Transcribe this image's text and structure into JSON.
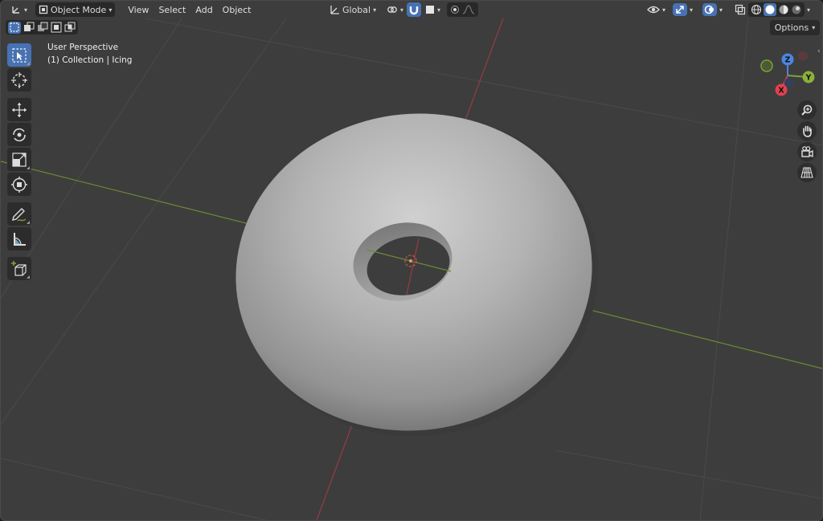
{
  "header": {
    "mode_label": "Object Mode",
    "menus": [
      "View",
      "Select",
      "Add",
      "Object"
    ],
    "transform_orientation": "Global"
  },
  "options_label": "Options",
  "viewport": {
    "view_name": "User Perspective",
    "collection_info": "(1) Collection | Icing"
  },
  "gizmo": {
    "z": "Z",
    "y": "Y",
    "x": "X"
  },
  "colors": {
    "viewport_bg": "#3d3d3d",
    "active_blue": "#4772b3",
    "x_axis": "#c94452",
    "y_axis": "#7ea33a",
    "z_axis": "#4b86e0"
  },
  "icons": {
    "toolbar": [
      "select-box-icon",
      "cursor-icon",
      "move-icon",
      "rotate-icon",
      "scale-icon",
      "transform-icon",
      "annotate-icon",
      "measure-icon",
      "add-cube-icon"
    ],
    "navigation": [
      "zoom-icon",
      "pan-hand-icon",
      "camera-icon",
      "grid-perspective-icon"
    ]
  }
}
